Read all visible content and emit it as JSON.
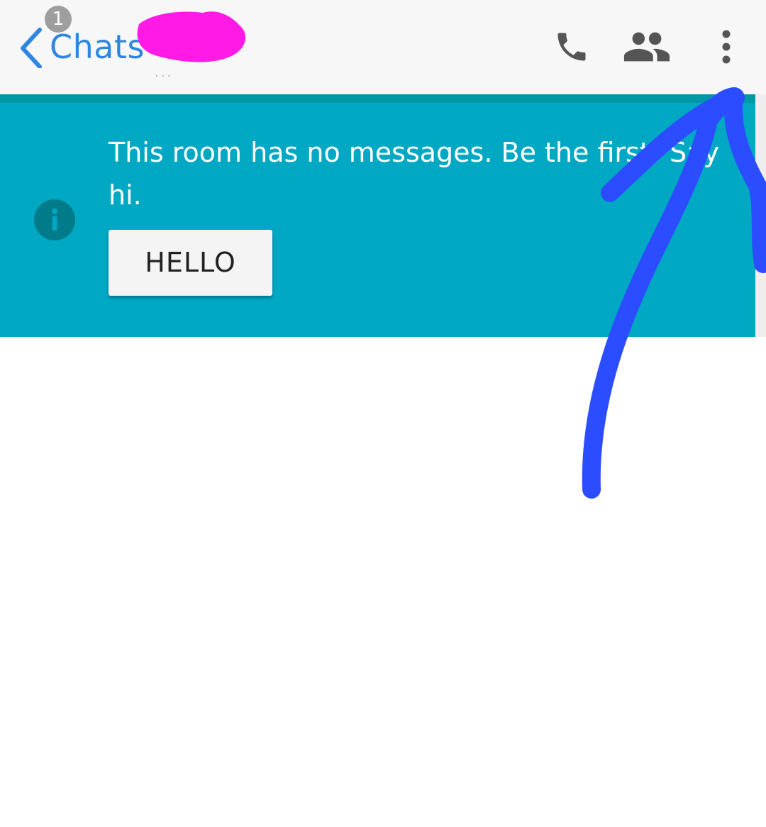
{
  "header": {
    "back_label": "Chats",
    "unread_count": "1",
    "title_dots": "...",
    "icons": {
      "back": "chevron-left-icon",
      "call": "phone-icon",
      "members": "people-icon",
      "menu": "more-vert-icon"
    }
  },
  "banner": {
    "message": "This room has no messages. Be the first! Say hi.",
    "button_label": "HELLO",
    "icon": "info-icon"
  },
  "colors": {
    "header_bg": "#f7f7f7",
    "accent_blue": "#2e86e0",
    "banner_teal": "#00a8c3",
    "teal_strip": "#0097a7",
    "badge_gray": "#9e9e9e",
    "icon_gray": "#555555",
    "redaction_magenta": "#ff1ae6",
    "annotation_blue": "#2b4dff"
  }
}
